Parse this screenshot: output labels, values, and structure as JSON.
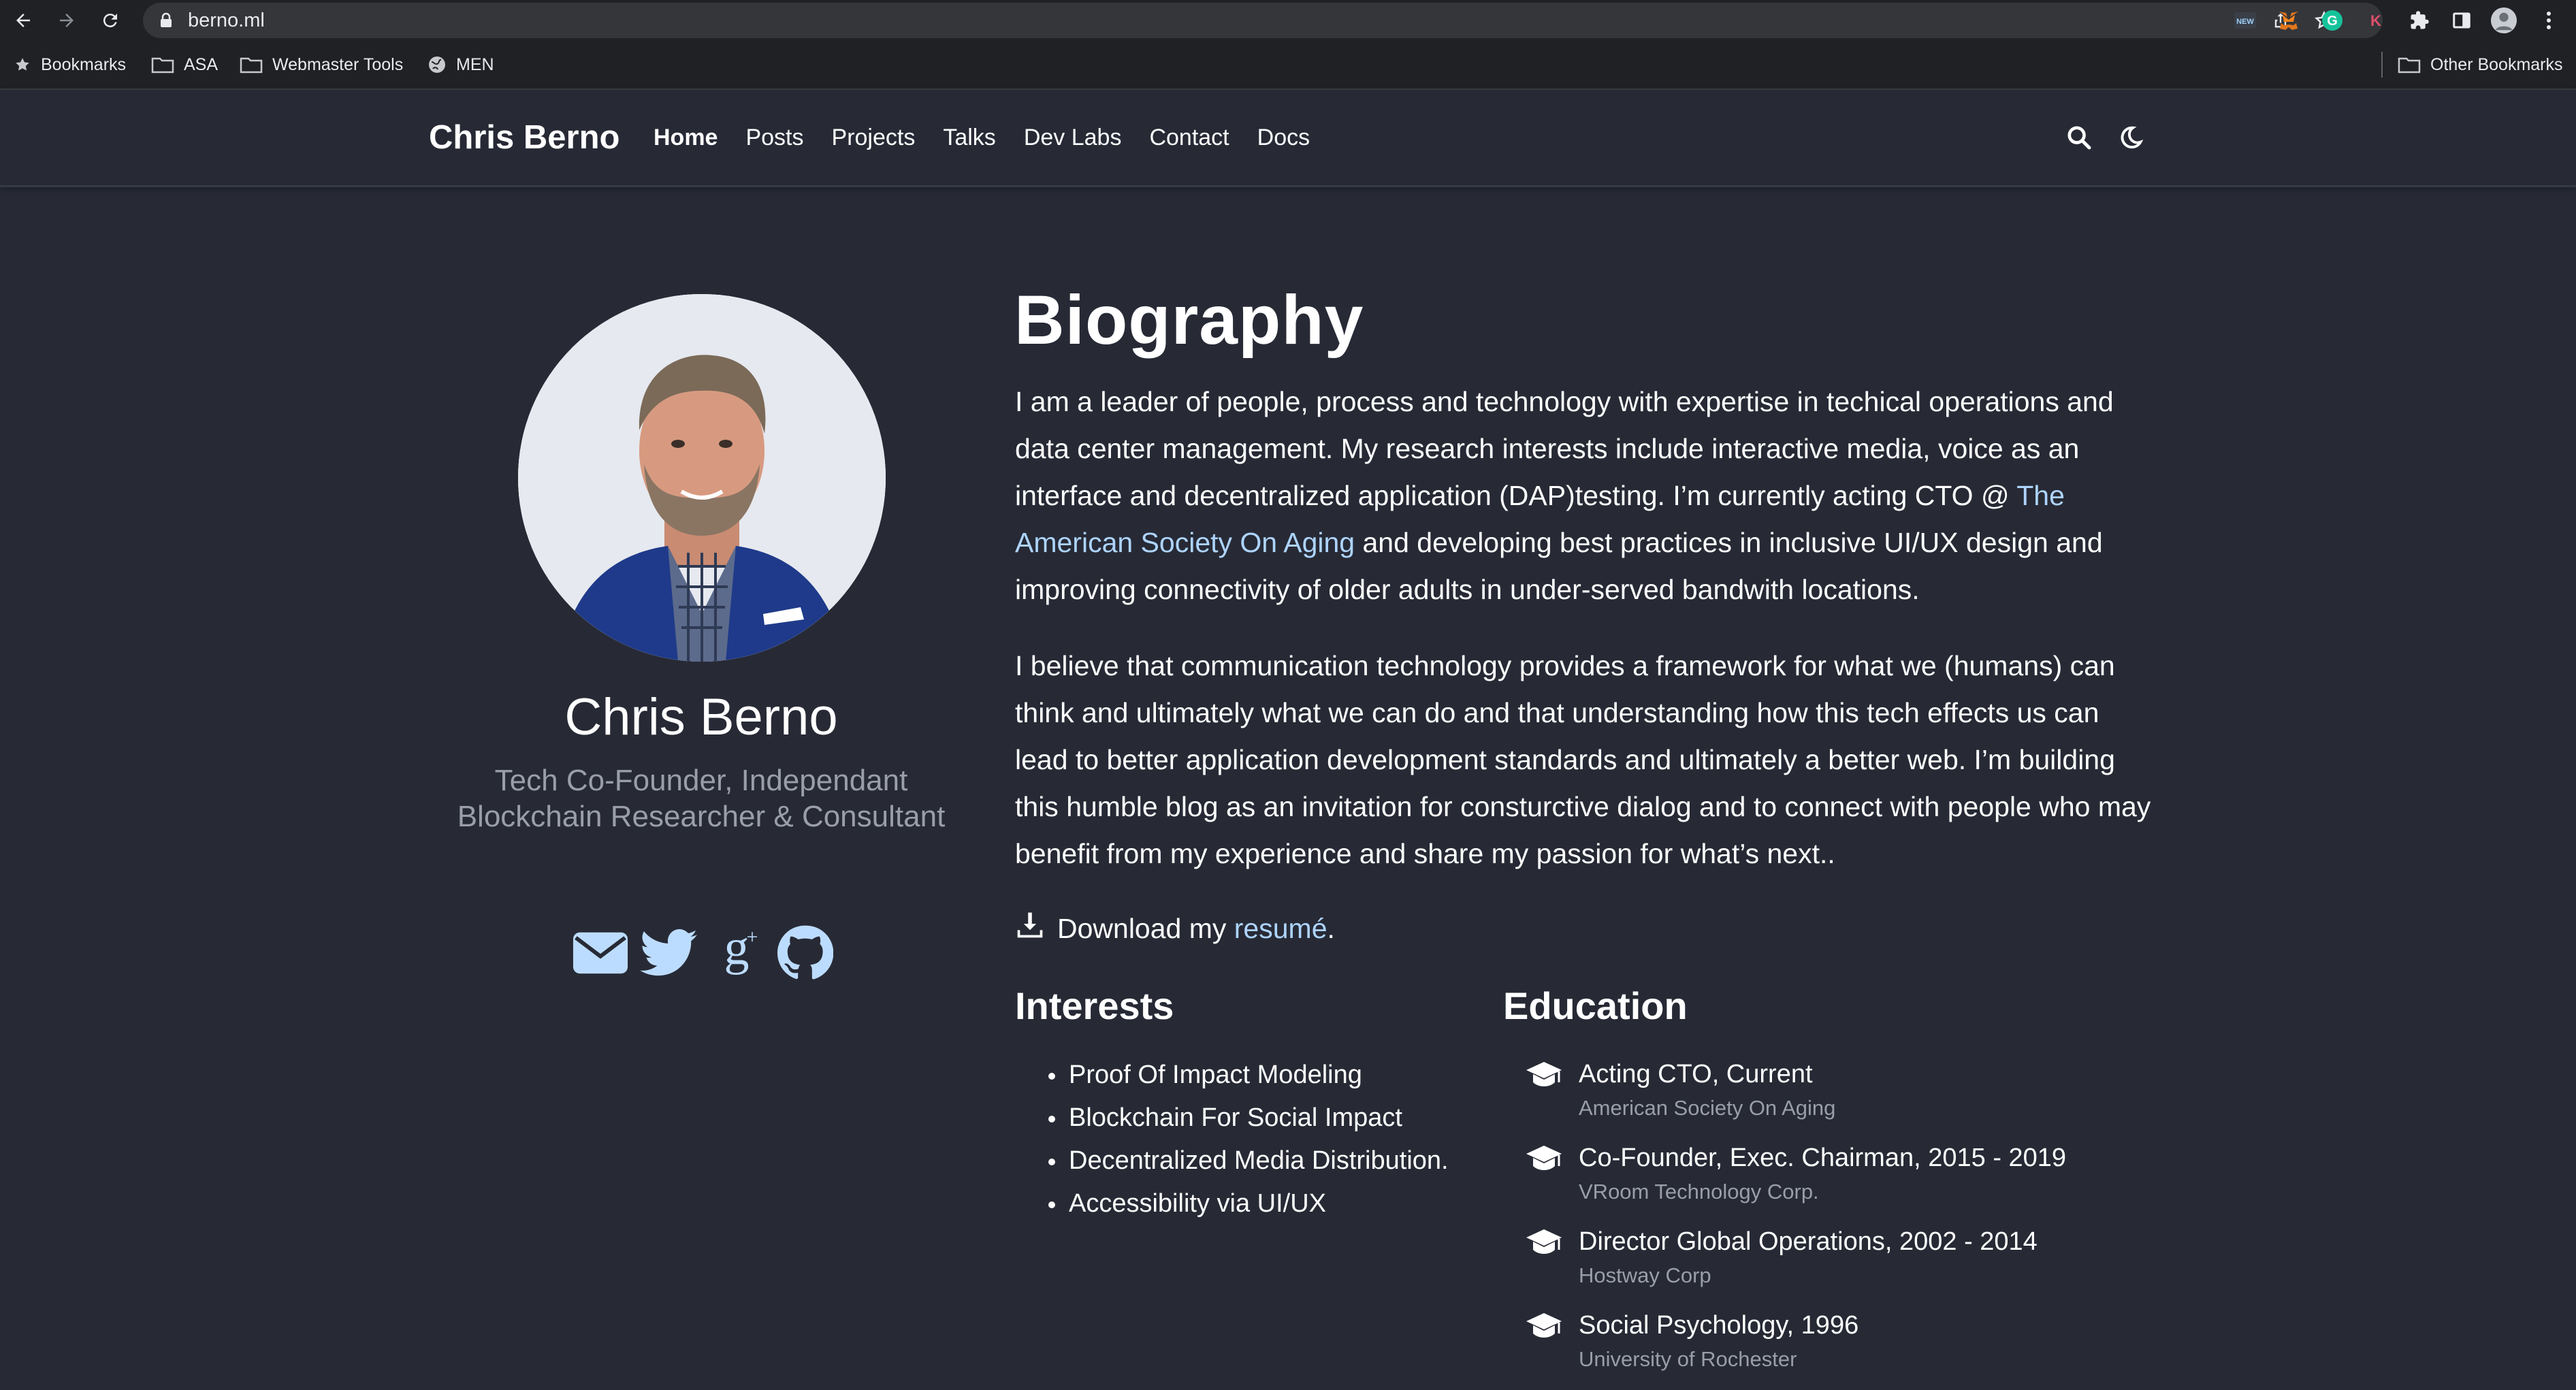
{
  "browser": {
    "url": "berno.ml",
    "bookmarks": [
      {
        "label": "Bookmarks",
        "icon": "star-icon"
      },
      {
        "label": "ASA",
        "icon": "folder-icon"
      },
      {
        "label": "Webmaster Tools",
        "icon": "folder-icon"
      },
      {
        "label": "MEN",
        "icon": "globe-icon"
      }
    ],
    "other_bookmarks": "Other Bookmarks",
    "extension_badge": "NEW",
    "extension_k": "K"
  },
  "site": {
    "brand": "Chris Berno",
    "nav": [
      "Home",
      "Posts",
      "Projects",
      "Talks",
      "Dev Labs",
      "Contact",
      "Docs"
    ],
    "active_nav": "Home"
  },
  "profile": {
    "name": "Chris Berno",
    "role": "Tech Co-Founder, Independant Blockchain Researcher & Consultant",
    "socials": [
      "envelope-icon",
      "twitter-icon",
      "google-scholar-icon",
      "github-icon"
    ]
  },
  "bio": {
    "title": "Biography",
    "p1_before": "I am a leader of people, process and technology with expertise in techical operations and data center management. My research interests include interactive media, voice as an interface and decentralized application (DAP)testing. I’m currently acting CTO @ ",
    "p1_link": "The American Society On Aging",
    "p1_after": " and developing best practices in inclusive UI/UX design and improving connectivity of older adults in under-served bandwith locations.",
    "p2": "I believe that communication technology provides a framework for what we (humans) can think and ultimately what we can do and that understanding how this tech effects us can lead to better application development standards and ultimately a better web. I’m building this humble blog as an invitation for consturctive dialog and to connect with people who may benefit from my experience and share my passion for what’s next..",
    "resume_prefix": "Download my ",
    "resume_link": "resumé",
    "resume_suffix": "."
  },
  "interests": {
    "title": "Interests",
    "items": [
      "Proof Of Impact Modeling",
      "Blockchain For Social Impact",
      "Decentralized Media Distribution.",
      "Accessibility via UI/UX"
    ]
  },
  "education": {
    "title": "Education",
    "items": [
      {
        "course": "Acting CTO, Current",
        "institution": "American Society On Aging"
      },
      {
        "course": "Co-Founder, Exec. Chairman, 2015 - 2019",
        "institution": "VRoom Technology Corp."
      },
      {
        "course": "Director Global Operations, 2002 - 2014",
        "institution": "Hostway Corp"
      },
      {
        "course": "Social Psychology, 1996",
        "institution": "University of Rochester"
      }
    ]
  },
  "colors": {
    "background": "#272a35",
    "link": "#aed4ff",
    "muted": "#9a9ea8",
    "social": "#bcdcff"
  }
}
